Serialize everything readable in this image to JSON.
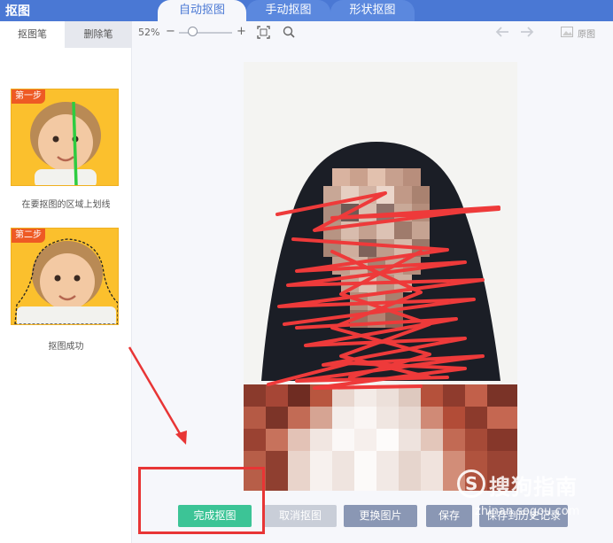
{
  "app": {
    "title": "抠图"
  },
  "tabs": [
    {
      "label": "自动抠图",
      "active": true
    },
    {
      "label": "手动抠图",
      "active": false
    },
    {
      "label": "形状抠图",
      "active": false
    }
  ],
  "left_panel": {
    "tabs": [
      {
        "label": "抠图笔",
        "active": true
      },
      {
        "label": "删除笔",
        "active": false
      }
    ],
    "steps": [
      {
        "badge": "第一步",
        "caption": "在要抠图的区域上划线"
      },
      {
        "badge": "第二步",
        "caption": "抠图成功"
      }
    ]
  },
  "toolbar": {
    "zoom": "52%",
    "zoom_level": 0.25,
    "original_label": "原图",
    "icons": [
      "zoom-out-icon",
      "zoom-in-icon",
      "fit-icon",
      "magnify-icon",
      "undo-icon",
      "redo-icon",
      "image-icon"
    ]
  },
  "buttons": {
    "finish": "完成抠图",
    "cancel": "取消抠图",
    "replace": "更换图片",
    "save": "保存",
    "save_history": "保存到历史记录"
  },
  "watermark": {
    "text": "搜狗指南",
    "url": "zhinan.sogou.com"
  },
  "colors": {
    "header": "#4a78d4",
    "finish_button": "#3cc496",
    "annotation": "#e83535",
    "step_card": "#fbc02d",
    "step_badge": "#ee5a24"
  }
}
